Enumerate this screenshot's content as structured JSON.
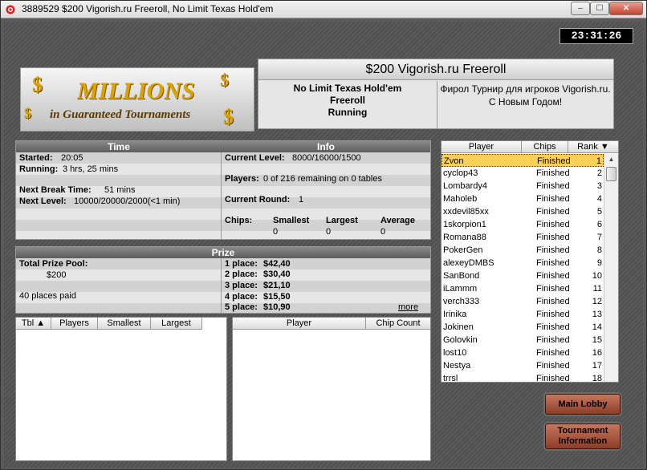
{
  "window": {
    "title": "3889529 $200 Vigorish.ru Freeroll, No Limit Texas Hold'em",
    "min_label": "–",
    "max_label": "☐",
    "close_label": "✕"
  },
  "clock": "23:31:26",
  "banner": {
    "line1": "MILLIONS",
    "line2": "in Guaranteed Tournaments"
  },
  "tournament": {
    "title": "$200 Vigorish.ru Freeroll",
    "game": "No Limit Texas Hold'em",
    "type": "Freeroll",
    "status": "Running",
    "description": "Фирол Турнир для игроков Vigorish.ru. С Новым Годом!"
  },
  "time": {
    "header": "Time",
    "started_label": "Started:",
    "started_value": "20:05",
    "running_label": "Running:",
    "running_value": "3 hrs, 25 mins",
    "next_break_label": "Next Break Time:",
    "next_break_value": "51 mins",
    "next_level_label": "Next Level:",
    "next_level_value": "10000/20000/2000(<1 min)"
  },
  "info": {
    "header": "Info",
    "current_level_label": "Current Level:",
    "current_level_value": "8000/16000/1500",
    "players_label": "Players:",
    "players_value": "0 of 216 remaining on 0 tables",
    "current_round_label": "Current Round:",
    "current_round_value": "1",
    "chips_label": "Chips:",
    "smallest_label": "Smallest",
    "largest_label": "Largest",
    "average_label": "Average",
    "smallest_value": "0",
    "largest_value": "0",
    "average_value": "0"
  },
  "prize": {
    "header": "Prize",
    "pool_label": "Total Prize Pool:",
    "pool_value": "$200",
    "places_paid": "40 places paid",
    "places": [
      {
        "label": "1 place:",
        "value": "$42,40"
      },
      {
        "label": "2 place:",
        "value": "$30,40"
      },
      {
        "label": "3 place:",
        "value": "$21,10"
      },
      {
        "label": "4 place:",
        "value": "$15,50"
      },
      {
        "label": "5 place:",
        "value": "$10,90"
      }
    ],
    "more_link": "more"
  },
  "tables_list": {
    "columns": [
      "Tbl",
      "Players",
      "Smallest",
      "Largest"
    ]
  },
  "table_players_list": {
    "columns": [
      "Player",
      "Chip Count"
    ]
  },
  "player_list": {
    "columns": [
      "Player",
      "Chips",
      "Rank"
    ],
    "rows": [
      {
        "name": "Zvon",
        "status": "Finished",
        "rank": "1"
      },
      {
        "name": "cyclop43",
        "status": "Finished",
        "rank": "2"
      },
      {
        "name": "Lombardy4",
        "status": "Finished",
        "rank": "3"
      },
      {
        "name": "Maholeb",
        "status": "Finished",
        "rank": "4"
      },
      {
        "name": "xxdevil85xx",
        "status": "Finished",
        "rank": "5"
      },
      {
        "name": "1skorpion1",
        "status": "Finished",
        "rank": "6"
      },
      {
        "name": "Romana88",
        "status": "Finished",
        "rank": "7"
      },
      {
        "name": "PokerGen",
        "status": "Finished",
        "rank": "8"
      },
      {
        "name": "alexeyDMBS",
        "status": "Finished",
        "rank": "9"
      },
      {
        "name": "SanBond",
        "status": "Finished",
        "rank": "10"
      },
      {
        "name": "iLammm",
        "status": "Finished",
        "rank": "11"
      },
      {
        "name": "verch333",
        "status": "Finished",
        "rank": "12"
      },
      {
        "name": "Irinika",
        "status": "Finished",
        "rank": "13"
      },
      {
        "name": "Jokinen",
        "status": "Finished",
        "rank": "14"
      },
      {
        "name": "Golovkin",
        "status": "Finished",
        "rank": "15"
      },
      {
        "name": "lost10",
        "status": "Finished",
        "rank": "16"
      },
      {
        "name": "Nestya",
        "status": "Finished",
        "rank": "17"
      },
      {
        "name": "trrsl",
        "status": "Finished",
        "rank": "18"
      }
    ]
  },
  "buttons": {
    "main_lobby": "Main Lobby",
    "tournament_info_line1": "Tournament",
    "tournament_info_line2": "Information"
  },
  "colors": {
    "selected_row": "#fccf57",
    "button_accent": "#a8553b",
    "header_bar": "#6e6e6e"
  }
}
